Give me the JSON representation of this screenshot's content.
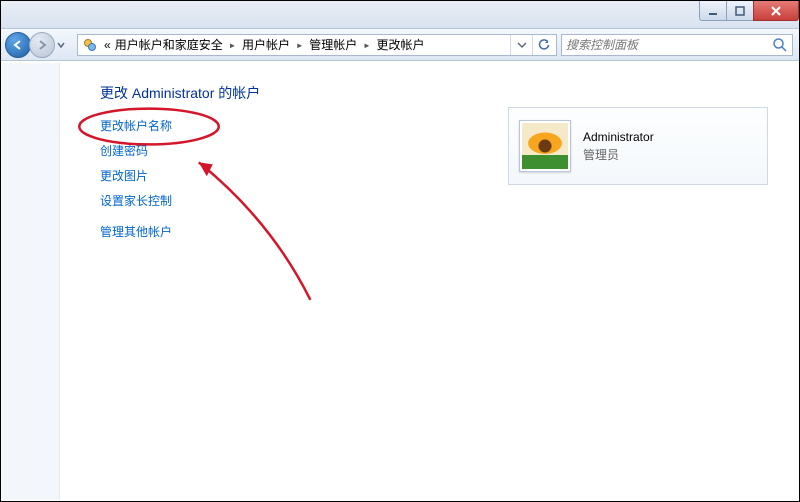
{
  "window": {
    "min_tooltip": "最小化",
    "max_tooltip": "最大化",
    "close_tooltip": "关闭"
  },
  "breadcrumbs": {
    "prefix": "«",
    "items": [
      "用户帐户和家庭安全",
      "用户帐户",
      "管理帐户",
      "更改帐户"
    ]
  },
  "search": {
    "placeholder": "搜索控制面板"
  },
  "page": {
    "title": "更改 Administrator 的帐户"
  },
  "links": {
    "change_name": "更改帐户名称",
    "create_password": "创建密码",
    "change_picture": "更改图片",
    "parental_controls": "设置家长控制",
    "manage_other": "管理其他帐户"
  },
  "user": {
    "name": "Administrator",
    "role": "管理员"
  }
}
